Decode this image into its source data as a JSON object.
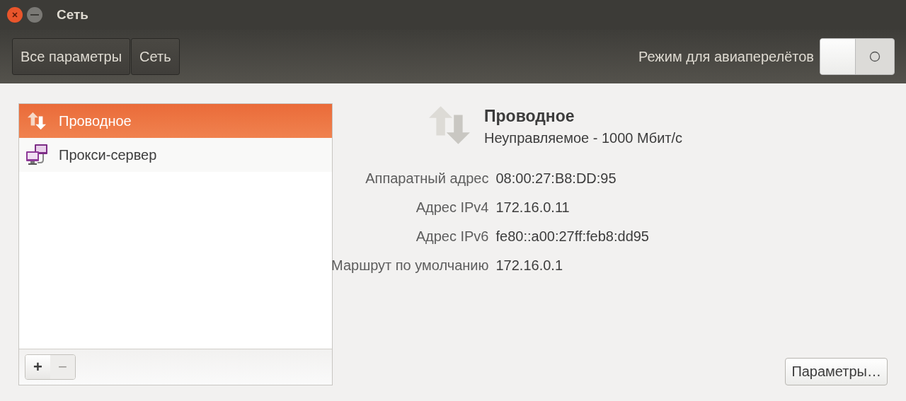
{
  "window": {
    "title": "Сеть"
  },
  "toolbar": {
    "breadcrumbs": [
      {
        "label": "Все параметры"
      },
      {
        "label": "Сеть"
      }
    ],
    "airplane_mode": {
      "label": "Режим для авиаперелётов",
      "on": false
    }
  },
  "connections": {
    "items": [
      {
        "label": "Проводное",
        "kind": "wired",
        "selected": true
      },
      {
        "label": "Прокси-сервер",
        "kind": "proxy",
        "selected": false
      }
    ],
    "buttons": [
      {
        "label": "+",
        "disabled": false
      },
      {
        "label": "−",
        "disabled": true
      }
    ]
  },
  "details": {
    "title": "Проводное",
    "subtitle": "Неуправляемое - 1000 Мбит/с",
    "fields": [
      {
        "label": "Аппаратный адрес",
        "value": "08:00:27:B8:DD:95"
      },
      {
        "label": "Адрес IPv4",
        "value": "172.16.0.11"
      },
      {
        "label": "Адрес IPv6",
        "value": "fe80::a00:27ff:feb8:dd95"
      },
      {
        "label": "Маршрут по умолчанию",
        "value": "172.16.0.1"
      }
    ],
    "button": "Параметры…"
  }
}
